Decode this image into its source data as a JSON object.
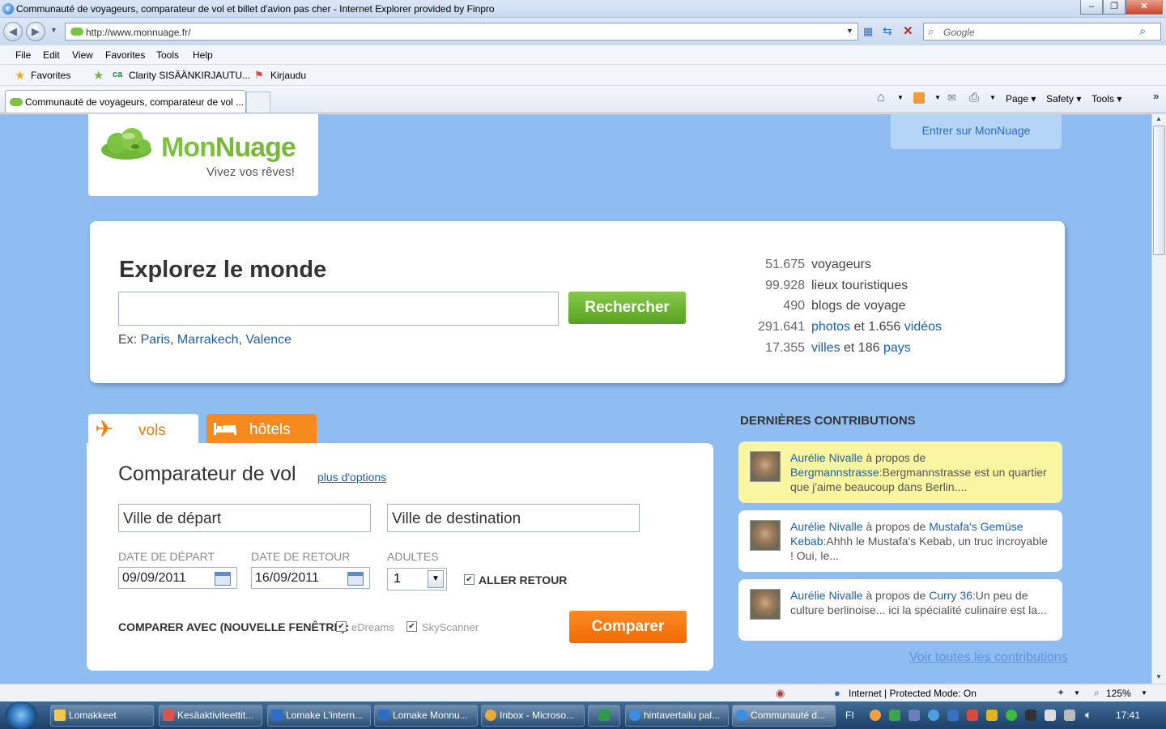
{
  "browser": {
    "window_title": "Communauté de voyageurs, comparateur de vol et billet d'avion pas cher - Internet Explorer provided by Finpro",
    "address": "http://www.monnuage.fr/",
    "search_placeholder": "Google",
    "menu": [
      "File",
      "Edit",
      "View",
      "Favorites",
      "Tools",
      "Help"
    ],
    "favorites_label": "Favorites",
    "favorites_items": [
      "Clarity  SISÄÄNKIRJAUTU...",
      "Kirjaudu"
    ],
    "tab_title": "Communauté de voyageurs, comparateur de vol ...",
    "command_bar": [
      "Page",
      "Safety",
      "Tools"
    ],
    "status_zone": "Internet | Protected Mode: On",
    "zoom": "125%"
  },
  "site": {
    "brand": "MonNuage",
    "brand_part1": "Mon",
    "brand_part2": "Nuage",
    "tagline": "Vivez vos rêves!",
    "enter_link": "Entrer sur MonNuage",
    "explore": {
      "heading": "Explorez le monde",
      "search_button": "Rechercher",
      "examples_prefix": "Ex:",
      "examples": [
        "Paris",
        "Marrakech",
        "Valence"
      ]
    },
    "stats": [
      {
        "num": "51.675",
        "label": "voyageurs"
      },
      {
        "num": "99.928",
        "label": "lieux touristiques"
      },
      {
        "num": "490",
        "label": "blogs de voyage"
      },
      {
        "num": "291.641",
        "label": "photos",
        "mid": "et 1.656",
        "label2": "vidéos"
      },
      {
        "num": "17.355",
        "label": "villes",
        "mid": "et 186",
        "label2": "pays"
      }
    ],
    "tabs": {
      "flights": "vols",
      "hotels": "hôtels"
    },
    "flight": {
      "heading": "Comparateur de vol",
      "more_options": "plus d'options",
      "departure_city": "Ville de départ",
      "destination_city": "Ville de destination",
      "departure_date_label": "DATE DE DÉPART",
      "return_date_label": "DATE DE RETOUR",
      "adults_label": "ADULTES",
      "departure_date": "09/09/2011",
      "return_date": "16/09/2011",
      "adults": "1",
      "round_trip": "ALLER RETOUR",
      "compare_with": "COMPARER AVEC (NOUVELLE FENÊTRE):",
      "partner1": "eDreams",
      "partner2": "SkyScanner",
      "compare_button": "Comparer"
    },
    "contributions": {
      "title": "DERNIÈRES CONTRIBUTIONS",
      "items": [
        {
          "author": "Aurélie Nivalle",
          "about": "à propos de",
          "place": "Bergmannstrasse",
          "text": ":Bergmannstrasse est un quartier que j'aime beaucoup dans Berlin...."
        },
        {
          "author": "Aurélie Nivalle",
          "about": "à propos de",
          "place": "Mustafa's Gemüse Kebab",
          "text": ":Ahhh le Mustafa's Kebab, un truc incroyable ! Oui, le..."
        },
        {
          "author": "Aurélie Nivalle",
          "about": "à propos de",
          "place": "Curry 36",
          "text": ":Un peu de culture berlinoise... ici la spécialité culinaire est la..."
        }
      ],
      "see_all": "Voir toutes les contributions"
    }
  },
  "taskbar": {
    "items": [
      "Lomakkeet",
      "Kesäaktiviteettit...",
      "Lomake L'intern...",
      "Lomake Monnu...",
      "Inbox - Microso...",
      "",
      "hintavertailu pal...",
      "Communauté d..."
    ],
    "lang": "FI",
    "time": "17:41"
  }
}
